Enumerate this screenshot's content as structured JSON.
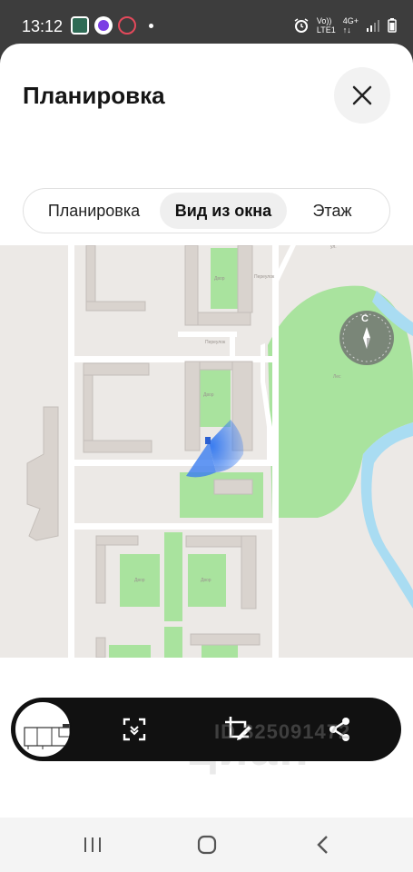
{
  "status_bar": {
    "time": "13:12",
    "network_line1": "Vo))",
    "network_line2": "LTE1",
    "network_type": "4G+"
  },
  "header": {
    "title": "Планировка"
  },
  "tabs": [
    {
      "label": "Планировка",
      "active": false
    },
    {
      "label": "Вид из окна",
      "active": true
    },
    {
      "label": "Этаж",
      "active": false
    }
  ],
  "map": {
    "compass_label": "С",
    "colors": {
      "park": "#a9e39e",
      "building": "#d9d3ce",
      "road": "#ffffff",
      "water": "#a9dcf2",
      "view_cone": "#3b7df0"
    }
  },
  "watermark": {
    "brand": "циан",
    "id_text": "ID 325091472"
  }
}
